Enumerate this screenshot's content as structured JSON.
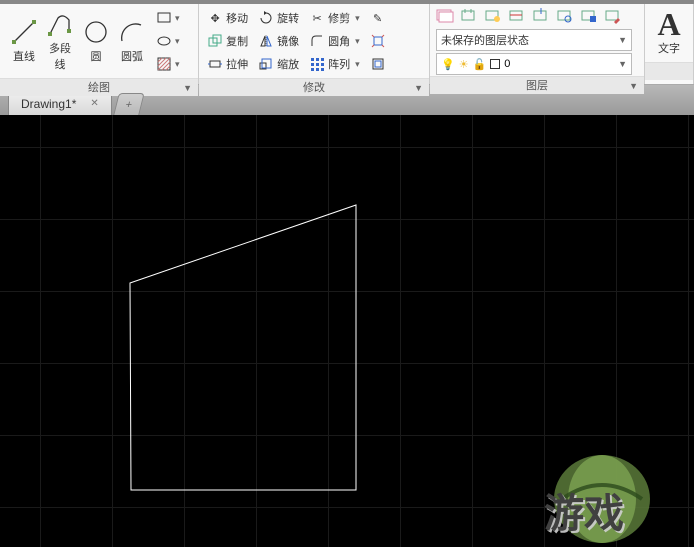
{
  "panels": {
    "draw": {
      "title": "绘图",
      "line": "直线",
      "polyline": "多段线",
      "circle": "圆",
      "arc": "圆弧"
    },
    "modify": {
      "title": "修改",
      "move": "移动",
      "copy": "复制",
      "stretch": "拉伸",
      "rotate": "旋转",
      "mirror": "镜像",
      "scale": "缩放",
      "trim": "修剪",
      "fillet": "圆角",
      "array": "阵列"
    },
    "layer": {
      "title": "图层",
      "unsaved": "未保存的图层状态",
      "current_index": "0"
    },
    "text": {
      "title": "文字",
      "glyph": "A"
    }
  },
  "tabs": {
    "active": "Drawing1*",
    "new": "+"
  },
  "watermark": {
    "text": "游戏"
  }
}
